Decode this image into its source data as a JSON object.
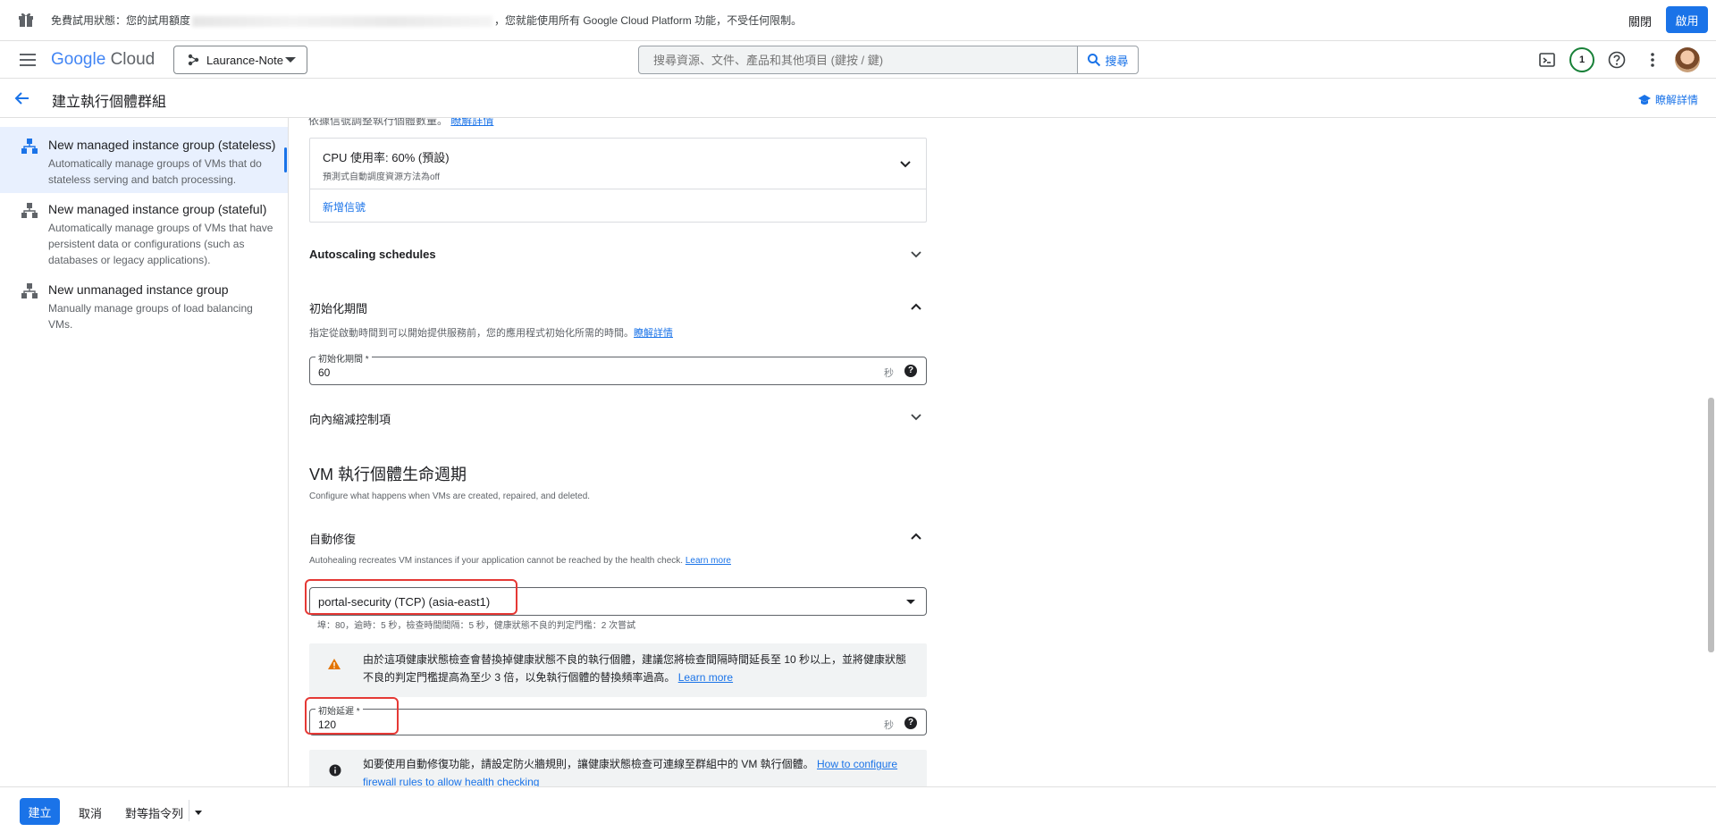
{
  "banner": {
    "text_prefix": "免費試用狀態：您的試用額度",
    "text_suffix": "，您就能使用所有 Google Cloud Platform 功能，不受任何限制。",
    "close_label": "關閉",
    "enable_label": "啟用"
  },
  "header": {
    "logo_google": "Google",
    "logo_cloud": "Cloud",
    "project_name": "Laurance-Note",
    "search_placeholder": "搜尋資源、文件、產品和其他項目 (鍵按 / 鍵)",
    "search_button": "搜尋",
    "notification_count": "1"
  },
  "subheader": {
    "title": "建立執行個體群組",
    "learn_more": "瞭解詳情"
  },
  "sidebar": {
    "items": [
      {
        "title": "New managed instance group (stateless)",
        "desc": "Automatically manage groups of VMs that do stateless serving and batch processing."
      },
      {
        "title": "New managed instance group (stateful)",
        "desc": "Automatically manage groups of VMs that have persistent data or configurations (such as databases or legacy applications)."
      },
      {
        "title": "New unmanaged instance group",
        "desc": "Manually manage groups of load balancing VMs."
      }
    ]
  },
  "main": {
    "cut_text": "依據信號調整執行個體數量。",
    "cut_link": "瞭解詳情",
    "signal": {
      "title": "CPU 使用率: 60% (預設)",
      "sub": "預測式自動調度資源方法為off",
      "add_signal": "新增信號"
    },
    "autoscaling_schedules": "Autoscaling schedules",
    "init_period": {
      "title": "初始化期間",
      "desc": "指定從啟動時間到可以開始提供服務前，您的應用程式初始化所需的時間。",
      "link": "瞭解詳情",
      "field_label": "初始化期間 *",
      "field_value": "60",
      "unit": "秒"
    },
    "scale_in": "向內縮減控制項",
    "lifecycle": {
      "title": "VM 執行個體生命週期",
      "desc": "Configure what happens when VMs are created, repaired, and deleted."
    },
    "autoheal": {
      "title": "自動修復",
      "desc": "Autohealing recreates VM instances if your application cannot be reached by the health check.",
      "link": "Learn more",
      "health_check": "portal-security (TCP) (asia-east1)",
      "health_info": "埠：80，逾時：5 秒，檢查時間間隔：5 秒，健康狀態不良的判定門檻：2 次嘗試",
      "warning": "由於這項健康狀態檢查會替換掉健康狀態不良的執行個體，建議您將檢查間隔時間延長至 10 秒以上，並將健康狀態不良的判定門檻提高為至少 3 倍，以免執行個體的替換頻率過高。",
      "warning_link": "Learn more",
      "delay_label": "初始延遲 *",
      "delay_value": "120",
      "delay_unit": "秒",
      "info": "如要使用自動修復功能，請設定防火牆規則，讓健康狀態檢查可連線至群組中的 VM 執行個體。",
      "info_link": "How to configure firewall rules to allow health checking"
    }
  },
  "footer": {
    "create": "建立",
    "cancel": "取消",
    "equivalent": "對等指令列"
  },
  "colors": {
    "primary": "#1a73e8",
    "highlight": "#e53935",
    "warning": "#e37400"
  }
}
